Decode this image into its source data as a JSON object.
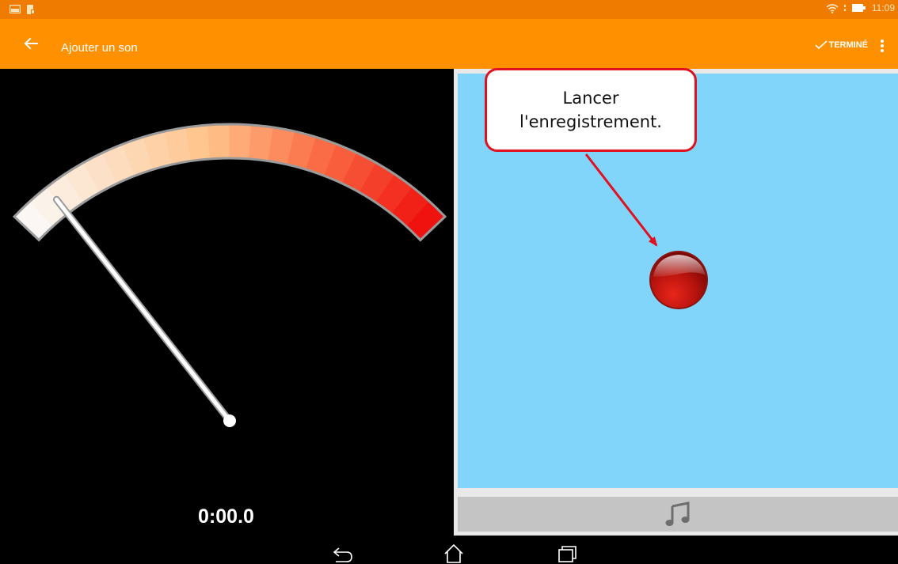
{
  "status_bar": {
    "time": "11:09",
    "left_icons": [
      "photo-notification-icon",
      "file-notification-icon"
    ],
    "right_icons": [
      "wifi-icon",
      "battery-icon"
    ]
  },
  "app_bar": {
    "title": "Ajouter un son",
    "done_label": "TERMINÉ",
    "icons": [
      "back-arrow-icon",
      "checkmark-icon",
      "more-vert-icon"
    ]
  },
  "meter": {
    "elapsed_time": "0:00.0",
    "needle_level": 0
  },
  "callout": {
    "line1": "Lancer",
    "line2": "l'enregistrement."
  },
  "record_button": {
    "icon": "record-button-icon"
  },
  "sound_bar": {
    "icon": "music-note-icon"
  },
  "nav_bar": {
    "icons": [
      "back-nav-icon",
      "home-nav-icon",
      "recents-nav-icon"
    ]
  },
  "colors": {
    "status_bar": "#ef7b00",
    "app_bar": "#ff9100",
    "blue_area": "#81d4fa",
    "callout_border": "#e0101e",
    "record": "#c41a14"
  }
}
